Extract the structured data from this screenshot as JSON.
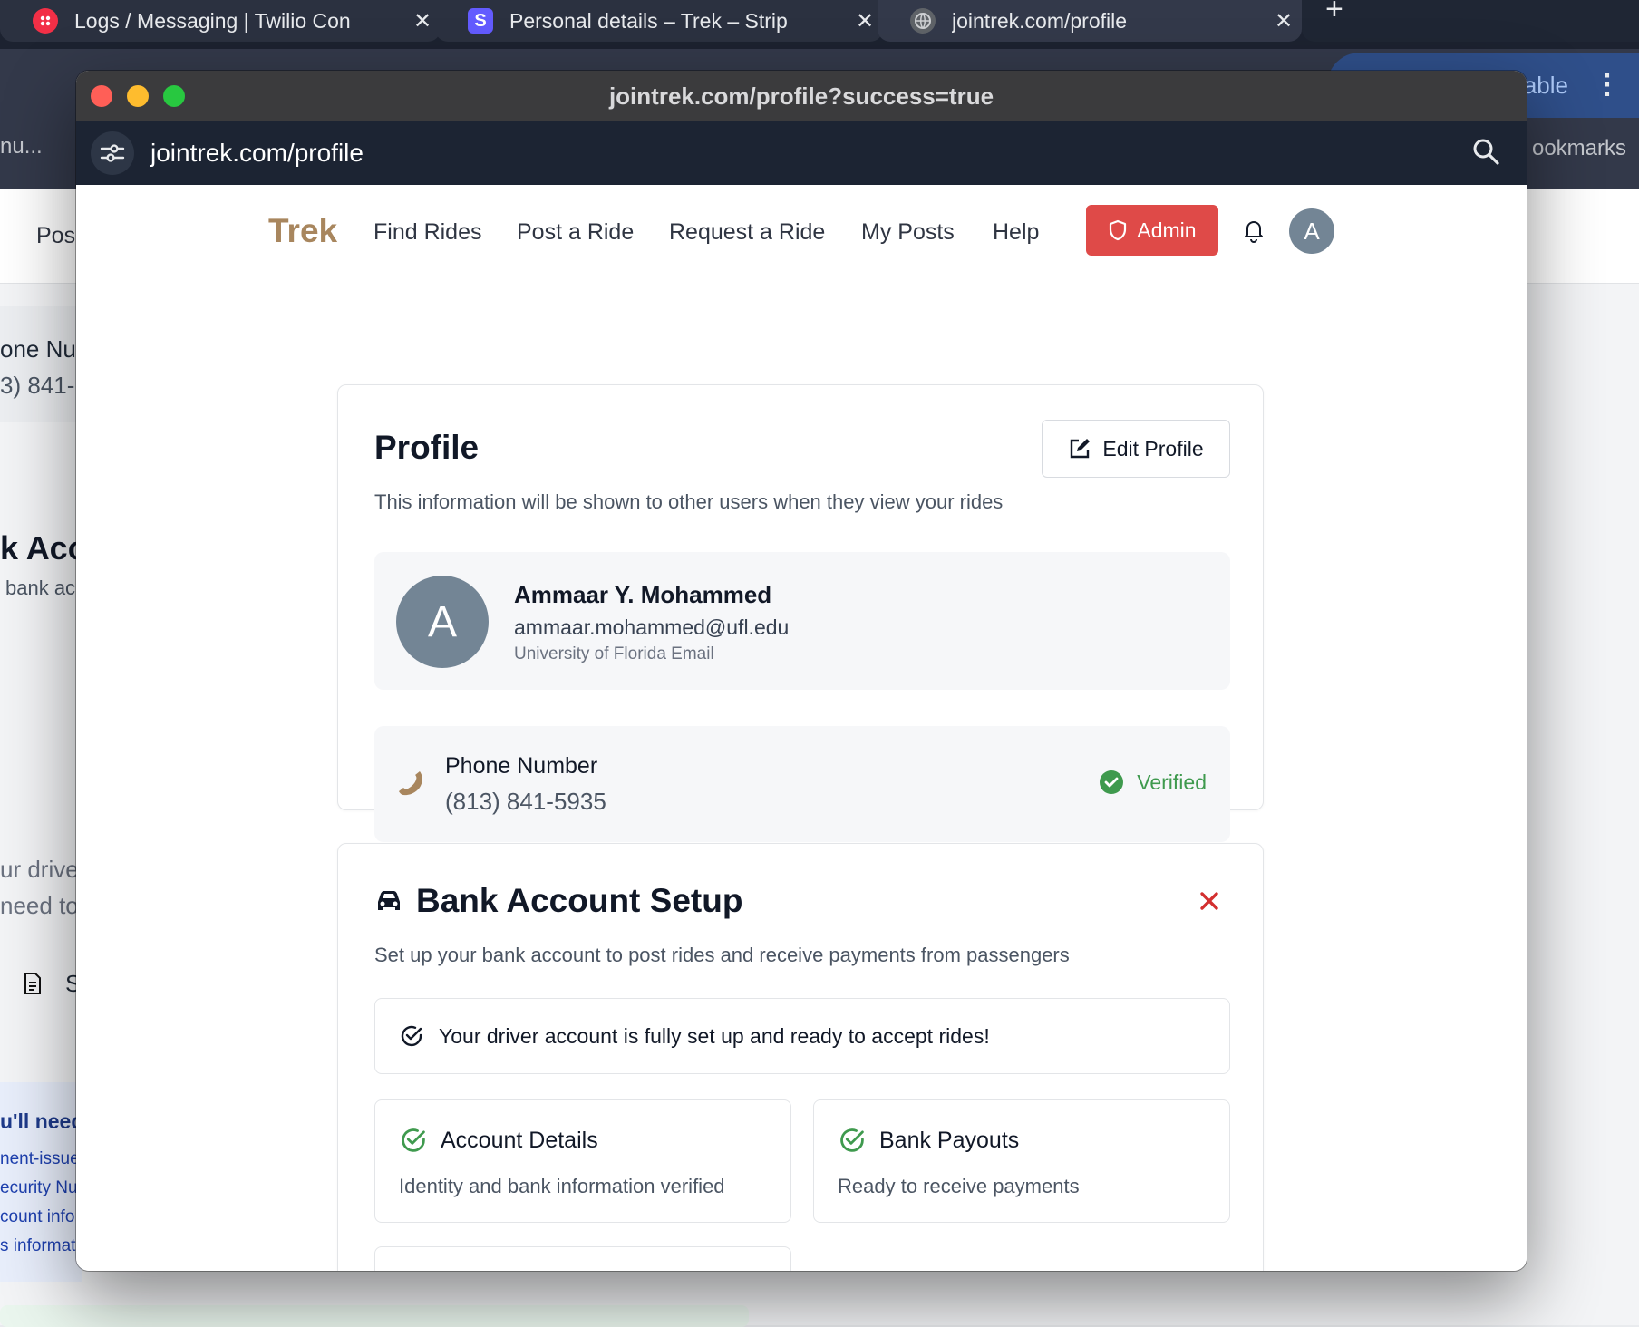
{
  "bg_browser": {
    "tabs": [
      {
        "title": "Logs / Messaging | Twilio Con",
        "favicon_color": "#f22f46",
        "favicon": "twilio-icon"
      },
      {
        "title": "Personal details – Trek – Strip",
        "favicon_color": "#635bff",
        "favicon_letter": "S"
      },
      {
        "title": "jointrek.com/profile",
        "favicon_color": "#5f6368",
        "favicon": "globe-icon"
      }
    ],
    "new_tab": "+",
    "pill_text": "ilable",
    "left_cut": "nu...",
    "bookmarks": "ookmarks",
    "page_fragments": [
      "Pos",
      "one Nur",
      "3) 841-",
      "k Acc",
      "bank ac",
      "ur drive",
      "need to",
      "S",
      "u'll need",
      "nent-issue",
      "ecurity Nu",
      "count info",
      "s informat"
    ]
  },
  "window": {
    "title": "jointrek.com/profile?success=true",
    "url": "jointrek.com/profile"
  },
  "nav": {
    "brand": "Trek",
    "links": [
      "Find Rides",
      "Post a Ride",
      "Request a Ride",
      "My Posts",
      "Help"
    ],
    "admin_label": "Admin",
    "avatar_letter": "A"
  },
  "profile": {
    "title": "Profile",
    "edit_label": "Edit Profile",
    "subtitle": "This information will be shown to other users when they view your rides",
    "avatar_letter": "A",
    "name": "Ammaar Y. Mohammed",
    "email": "ammaar.mohammed@ufl.edu",
    "email_note": "University of Florida Email",
    "phone_label": "Phone Number",
    "phone_value": "(813) 841-5935",
    "phone_status": "Verified"
  },
  "bank": {
    "title": "Bank Account Setup",
    "subtitle": "Set up your bank account to post rides and receive payments from passengers",
    "ready_message": "Your driver account is fully set up and ready to accept rides!",
    "cards": [
      {
        "title": "Account Details",
        "desc": "Identity and bank information verified"
      },
      {
        "title": "Bank Payouts",
        "desc": "Ready to receive payments"
      }
    ]
  },
  "colors": {
    "brand": "#a8865e",
    "admin": "#df4a48",
    "verified": "#3f9a4e",
    "close": "#d32f2f"
  }
}
